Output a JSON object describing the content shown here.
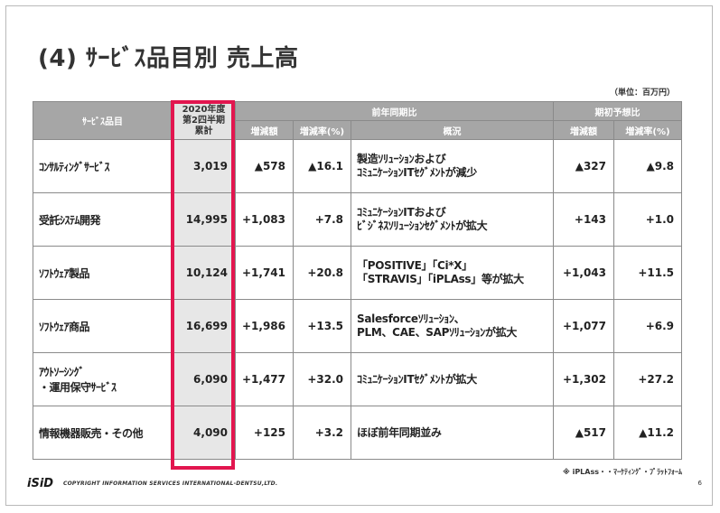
{
  "title": "(4) ｻｰﾋﾞｽ品目別 売上高",
  "unit": "（単位：百万円）",
  "headers": {
    "item": "ｻｰﾋﾞｽ品目",
    "q2_line1": "2020年度",
    "q2_line2": "第2四半期",
    "q2_line3": "累計",
    "yoy": "前年同期比",
    "plan": "期初予想比",
    "change": "増減額",
    "rate": "増減率(%)",
    "overview": "概況",
    "plan_change": "増減額",
    "plan_rate": "増減率(%)"
  },
  "rows": [
    {
      "name": "ｺﾝｻﾙﾃｨﾝｸﾞｻｰﾋﾞｽ",
      "value": "3,019",
      "change": "▲578",
      "rate": "▲16.1",
      "desc1": "製造ｿﾘｭｰｼｮﾝおよび",
      "desc2": "ｺﾐｭﾆｹｰｼｮﾝITｾｸﾞﾒﾝﾄが減少",
      "plan_change": "▲327",
      "plan_rate": "▲9.8"
    },
    {
      "name": "受託ｼｽﾃﾑ開発",
      "value": "14,995",
      "change": "+1,083",
      "rate": "+7.8",
      "desc1": "ｺﾐｭﾆｹｰｼｮﾝITおよび",
      "desc2": "ﾋﾞｼﾞﾈｽｿﾘｭｰｼｮﾝｾｸﾞﾒﾝﾄが拡大",
      "plan_change": "+143",
      "plan_rate": "+1.0"
    },
    {
      "name": "ｿﾌﾄｳｪｱ製品",
      "value": "10,124",
      "change": "+1,741",
      "rate": "+20.8",
      "desc1": "「POSITIVE」「Ci*X」",
      "desc2": "「STRAVIS」「iPLAss」等が拡大",
      "plan_change": "+1,043",
      "plan_rate": "+11.5"
    },
    {
      "name": "ｿﾌﾄｳｪｱ商品",
      "value": "16,699",
      "change": "+1,986",
      "rate": "+13.5",
      "desc1": "Salesforceｿﾘｭｰｼｮﾝ、",
      "desc2": "PLM、CAE、SAPｿﾘｭｰｼｮﾝが拡大",
      "plan_change": "+1,077",
      "plan_rate": "+6.9"
    },
    {
      "name": "ｱｳﾄｿｰｼﾝｸﾞ",
      "name2": "・運用保守ｻｰﾋﾞｽ",
      "value": "6,090",
      "change": "+1,477",
      "rate": "+32.0",
      "desc1": "ｺﾐｭﾆｹｰｼｮﾝITｾｸﾞﾒﾝﾄが拡大",
      "desc2": "",
      "plan_change": "+1,302",
      "plan_rate": "+27.2"
    },
    {
      "name": "情報機器販売・その他",
      "value": "4,090",
      "change": "+125",
      "rate": "+3.2",
      "desc1": "ほぼ前年同期並み",
      "desc2": "",
      "plan_change": "▲517",
      "plan_rate": "▲11.2"
    }
  ],
  "note": "※ iPLAss・・ﾏｰｹﾃｨﾝｸﾞ・ﾌﾟﾗｯﾄﾌｫｰﾑ",
  "footer": {
    "logo": "iSiD",
    "copyright": "COPYRIGHT  INFORMATION SERVICES INTERNATIONAL-DENTSU,LTD.",
    "page": "6"
  },
  "colors": {
    "header_bg": "#a6a6a6",
    "highlight_col": "#e7e7e7",
    "highlight_border": "#e2164f"
  }
}
